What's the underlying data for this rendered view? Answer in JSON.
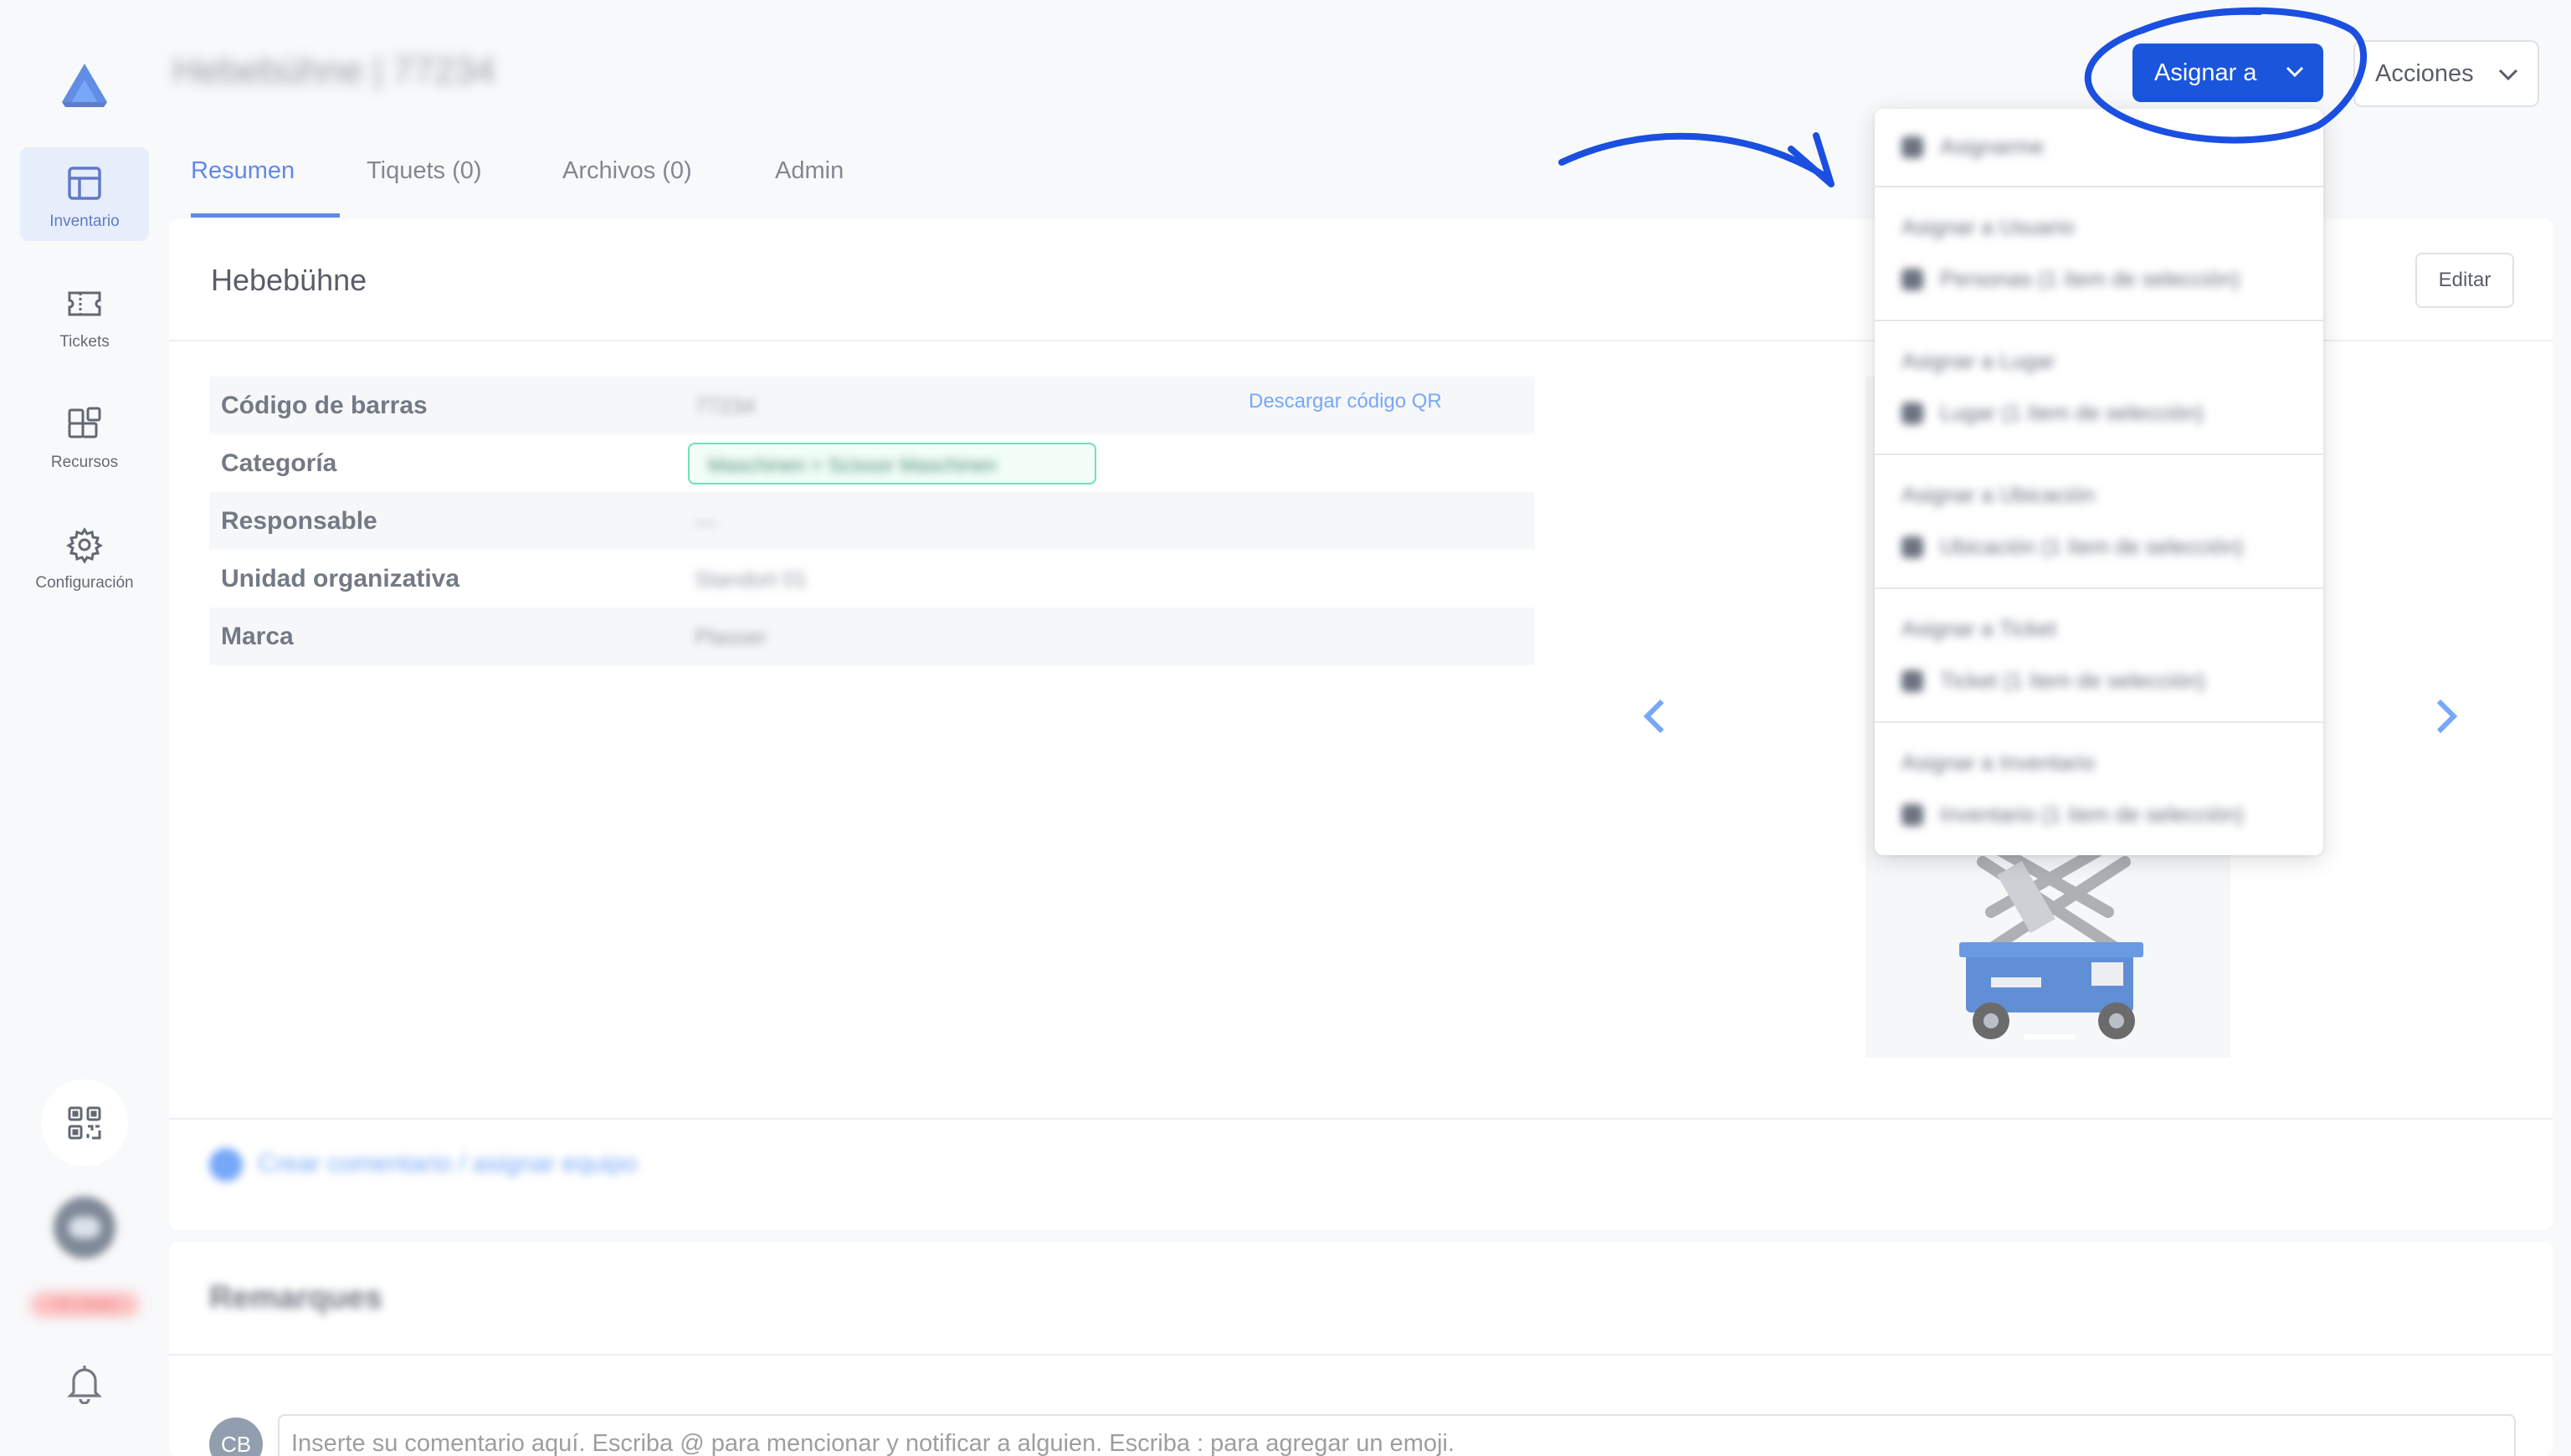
{
  "header": {
    "title": "Hebebühne | 77234",
    "assign_button": "Asignar a",
    "actions_button": "Acciones"
  },
  "sidebar": {
    "items": [
      {
        "label": "Inventario",
        "icon": "grid-icon",
        "active": true
      },
      {
        "label": "Tickets",
        "icon": "ticket-icon",
        "active": false
      },
      {
        "label": "Recursos",
        "icon": "resources-icon",
        "active": false
      },
      {
        "label": "Configuración",
        "icon": "gear-icon",
        "active": false
      }
    ],
    "status_badge": "Sin trabajo"
  },
  "tabs": [
    {
      "label": "Resumen",
      "active": true
    },
    {
      "label": "Tiquets (0)",
      "active": false
    },
    {
      "label": "Archivos (0)",
      "active": false
    },
    {
      "label": "Admin",
      "active": false
    }
  ],
  "main": {
    "card_title": "Hebebühne",
    "edit_button": "Editar",
    "rows": [
      {
        "key": "Código de barras",
        "value": "77234"
      },
      {
        "key": "Categoría",
        "value": "Maschinen > Scissor Maschinen"
      },
      {
        "key": "Responsable",
        "value": "—"
      },
      {
        "key": "Unidad organizativa",
        "value": "Standort 01"
      },
      {
        "key": "Marca",
        "value": "Plasser"
      }
    ],
    "qr_link": "Descargar código QR",
    "footer_link": "Crear comentario / asignar equipo"
  },
  "dropdown": {
    "items": [
      {
        "header": "",
        "row": "Asignarme"
      },
      {
        "header": "Asignar a Usuario",
        "row": "Personas (1 ítem de selección)"
      },
      {
        "header": "Asignar a Lugar",
        "row": "Lugar (1 ítem de selección)"
      },
      {
        "header": "Asignar a Ubicación",
        "row": "Ubicación (1 ítem de selección)"
      },
      {
        "header": "Asignar a Ticket",
        "row": "Ticket (1 ítem de selección)"
      },
      {
        "header": "Asignar a Inventario",
        "row": "Inventario (1 ítem de selección)"
      }
    ]
  },
  "comments": {
    "title": "Remarques",
    "avatar": "CB",
    "placeholder": "Inserte su comentario aquí. Escriba @ para mencionar y notificar a alguien. Escriba : para agregar un emoji."
  },
  "colors": {
    "accent": "#1a56db",
    "annotation": "#1a4fe0"
  }
}
